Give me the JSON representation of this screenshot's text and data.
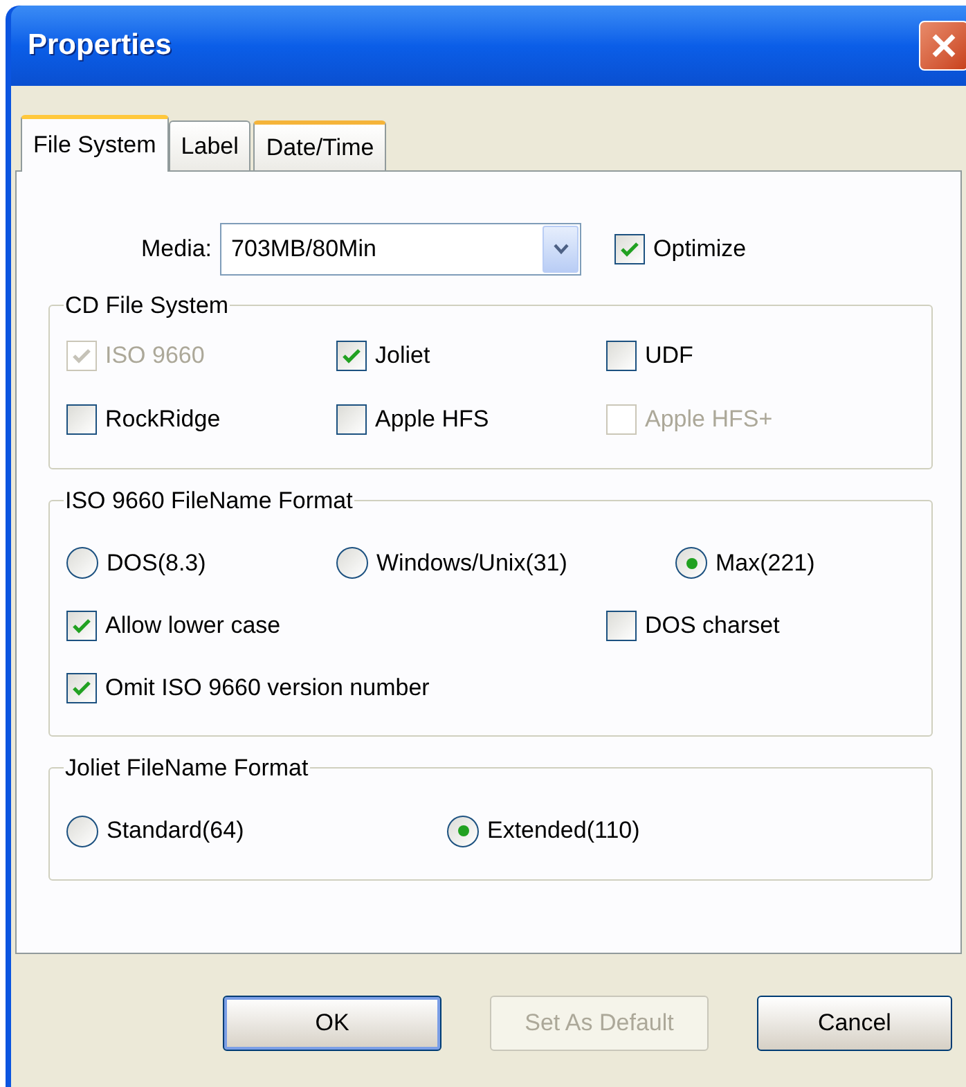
{
  "window": {
    "title": "Properties"
  },
  "tabs": [
    {
      "label": "File System",
      "selected": true,
      "hot": false
    },
    {
      "label": "Label",
      "selected": false,
      "hot": false
    },
    {
      "label": "Date/Time",
      "selected": false,
      "hot": true
    }
  ],
  "media": {
    "label": "Media:",
    "value": "703MB/80Min",
    "optimize": {
      "label": "Optimize",
      "checked": true
    }
  },
  "groups": [
    {
      "title": "CD File System",
      "checkboxes": [
        {
          "label": "ISO 9660",
          "checked": true,
          "disabled": true
        },
        {
          "label": "Joliet",
          "checked": true,
          "disabled": false
        },
        {
          "label": "UDF",
          "checked": false,
          "disabled": false
        },
        {
          "label": "RockRidge",
          "checked": false,
          "disabled": false
        },
        {
          "label": "Apple HFS",
          "checked": false,
          "disabled": false
        },
        {
          "label": "Apple HFS+",
          "checked": false,
          "disabled": true
        }
      ]
    },
    {
      "title": "ISO 9660 FileName Format",
      "radios": [
        {
          "label": "DOS(8.3)",
          "selected": false
        },
        {
          "label": "Windows/Unix(31)",
          "selected": false
        },
        {
          "label": "Max(221)",
          "selected": true
        }
      ],
      "checkboxes": [
        {
          "label": "Allow lower case",
          "checked": true,
          "disabled": false
        },
        {
          "label": "DOS charset",
          "checked": false,
          "disabled": false
        },
        {
          "label": "Omit ISO 9660 version number",
          "checked": true,
          "disabled": false
        }
      ]
    },
    {
      "title": "Joliet FileName Format",
      "radios": [
        {
          "label": "Standard(64)",
          "selected": false
        },
        {
          "label": "Extended(110)",
          "selected": true
        }
      ]
    }
  ],
  "buttons": [
    {
      "label": "OK",
      "disabled": false,
      "default": true
    },
    {
      "label": "Set As Default",
      "disabled": true,
      "default": false
    },
    {
      "label": "Cancel",
      "disabled": false,
      "default": false
    }
  ]
}
